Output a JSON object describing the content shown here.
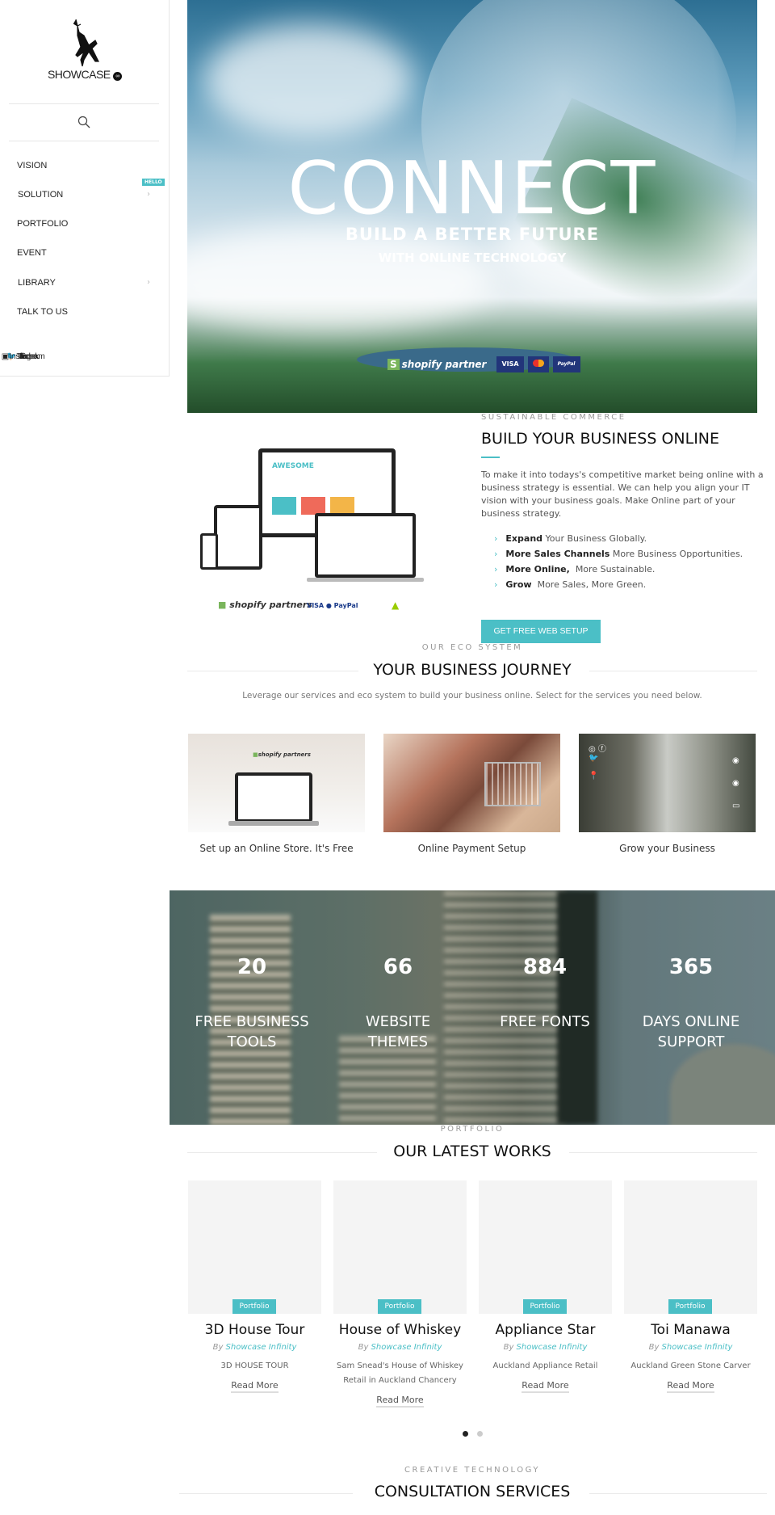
{
  "sidebar": {
    "logo_text": "SHOWCASE",
    "menu": [
      {
        "label": "VISION",
        "has_submenu": false
      },
      {
        "label": "SOLUTION",
        "has_submenu": true,
        "badge": "HELLO"
      },
      {
        "label": "PORTFOLIO",
        "has_submenu": false
      },
      {
        "label": "EVENT",
        "has_submenu": false
      },
      {
        "label": "LIBRARY",
        "has_submenu": true
      },
      {
        "label": "TALK TO US",
        "has_submenu": false
      }
    ],
    "social": [
      "Facebook",
      "Twitter",
      "Instagram"
    ]
  },
  "hero": {
    "title": "CONNECT",
    "subtitle": "BUILD A BETTER FUTURE",
    "tagline": "WITH ONLINE TECHNOLOGY",
    "badges": [
      "shopify partner",
      "VISA",
      "MasterCard",
      "PayPal"
    ]
  },
  "business": {
    "eyebrow": "SUSTAINABLE COMMERCE",
    "title": "BUILD YOUR BUSINESS ONLINE",
    "paragraph": "To make it into todays's competitive market being online with a business strategy is essential. We can help you align your IT vision with your business goals. Make Online part of your business strategy.",
    "bullets": [
      {
        "bold": "Expand",
        "text": " Your Business Globally."
      },
      {
        "bold": "More Sales Channels",
        "text": " More Business Opportunities."
      },
      {
        "bold": "More Online,",
        "text": "  More Sustainable."
      },
      {
        "bold": "Grow",
        "text": "  More Sales, More Green."
      }
    ],
    "button": "GET FREE WEB SETUP",
    "image_caption": "shopify partners"
  },
  "journey": {
    "eyebrow": "OUR ECO SYSTEM",
    "title": "YOUR BUSINESS JOURNEY",
    "subtitle": "Leverage our services and eco system to build your business online. Select for the services you need below.",
    "cards": [
      {
        "caption": "Set up an Online Store. It's Free"
      },
      {
        "caption": "Online Payment Setup"
      },
      {
        "caption": "Grow your Business"
      }
    ]
  },
  "stats": [
    {
      "value": "20",
      "label": "FREE BUSINESS TOOLS"
    },
    {
      "value": "66",
      "label": "WEBSITE THEMES"
    },
    {
      "value": "884",
      "label": "FREE FONTS"
    },
    {
      "value": "365",
      "label": "DAYS ONLINE SUPPORT"
    }
  ],
  "portfolio": {
    "eyebrow": "PORTFOLIO",
    "title": "OUR LATEST WORKS",
    "by": "By",
    "author": "Showcase Infinity",
    "read_more": "Read More",
    "items": [
      {
        "tag": "Portfolio",
        "title": "3D House Tour",
        "desc": "3D HOUSE TOUR"
      },
      {
        "tag": "Portfolio",
        "title": "House of Whiskey",
        "desc": "Sam Snead's House of Whiskey Retail in Auckland Chancery"
      },
      {
        "tag": "Portfolio",
        "title": "Appliance Star",
        "desc": "Auckland Appliance Retail"
      },
      {
        "tag": "Portfolio",
        "title": "Toi Manawa",
        "desc": "Auckland Green Stone Carver"
      }
    ],
    "carousel": {
      "pages": 2,
      "active": 1
    }
  },
  "consultation": {
    "eyebrow": "CREATIVE TECHNOLOGY",
    "title": "CONSULTATION SERVICES"
  },
  "colors": {
    "accent": "#4bbfc6",
    "text": "#222222",
    "muted": "#999999"
  }
}
